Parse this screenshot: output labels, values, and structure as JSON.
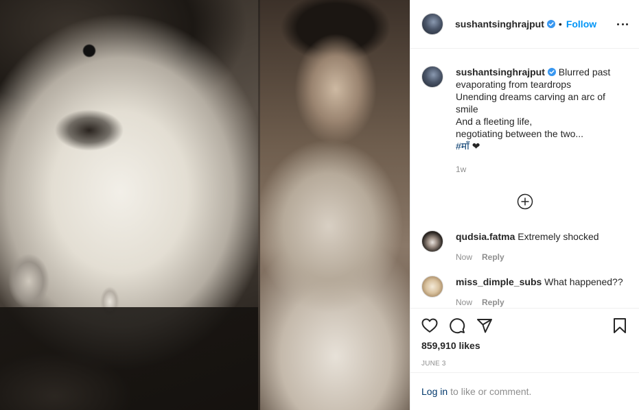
{
  "post": {
    "username": "sushantsinghrajput",
    "follow_label": "Follow",
    "dot": "•",
    "verified_icon": "verified-badge-icon",
    "accent_color": "#0095f6",
    "caption_lines": [
      "Blurred past",
      "evaporating from teardrops",
      "Unending dreams carving an arc of",
      "smile",
      "And a fleeting life,",
      "negotiating between the two..."
    ],
    "hashtag": "#माँ",
    "heart_emoji": "❤",
    "caption_age": "1w",
    "likes_text": "859,910 likes",
    "date": "JUNE 3"
  },
  "comments": [
    {
      "username": "qudsia.fatma",
      "text": "Extremely shocked",
      "age": "Now",
      "reply_label": "Reply"
    },
    {
      "username": "miss_dimple_subs",
      "text": "What happened??",
      "age": "Now",
      "reply_label": "Reply"
    }
  ],
  "footer": {
    "login_label": "Log in",
    "login_suffix": "to like or comment."
  }
}
